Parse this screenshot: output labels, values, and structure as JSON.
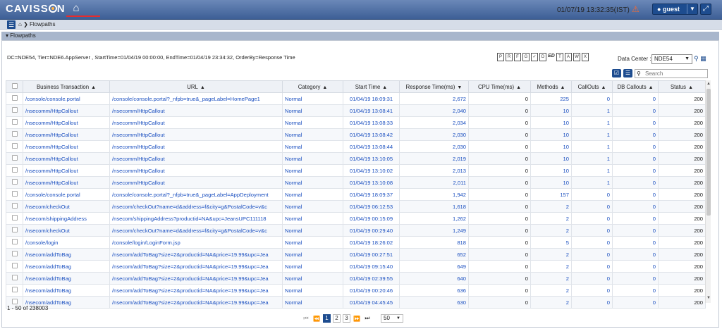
{
  "header": {
    "logo": "CAVISSON",
    "logo_left": "CAVISS",
    "logo_right": "N",
    "datetime": "01/07/19 13:32:35(IST)",
    "user": "guest"
  },
  "breadcrumb": {
    "label": "Flowpaths"
  },
  "panel": {
    "title": "Flowpaths"
  },
  "info": "DC=NDE54, Tier=NDE6.AppServer , StartTime=01/04/19 00:00:00, EndTime=01/04/19 23:34:32, OrderBy=Response Time",
  "datacenter": {
    "label": "Data Center :",
    "value": "NDE54"
  },
  "search": {
    "placeholder": "Search"
  },
  "columns": [
    "Business Transaction",
    "URL",
    "Category",
    "Start Time",
    "Response Time(ms)",
    "CPU Time(ms)",
    "Methods",
    "CallOuts",
    "DB Callouts",
    "Status"
  ],
  "rows": [
    [
      "/console/console.portal",
      "/console/console.portal?_nfpb=true&_pageLabel=HomePage1",
      "Normal",
      "01/04/19 18:09:31",
      "2,672",
      "0",
      "225",
      "0",
      "0",
      "200"
    ],
    [
      "/nsecomm/HttpCallout",
      "/nsecomm/HttpCallout",
      "Normal",
      "01/04/19 13:08:41",
      "2,040",
      "0",
      "10",
      "1",
      "0",
      "200"
    ],
    [
      "/nsecomm/HttpCallout",
      "/nsecomm/HttpCallout",
      "Normal",
      "01/04/19 13:08:33",
      "2,034",
      "0",
      "10",
      "1",
      "0",
      "200"
    ],
    [
      "/nsecomm/HttpCallout",
      "/nsecomm/HttpCallout",
      "Normal",
      "01/04/19 13:08:42",
      "2,030",
      "0",
      "10",
      "1",
      "0",
      "200"
    ],
    [
      "/nsecomm/HttpCallout",
      "/nsecomm/HttpCallout",
      "Normal",
      "01/04/19 13:08:44",
      "2,030",
      "0",
      "10",
      "1",
      "0",
      "200"
    ],
    [
      "/nsecomm/HttpCallout",
      "/nsecomm/HttpCallout",
      "Normal",
      "01/04/19 13:10:05",
      "2,019",
      "0",
      "10",
      "1",
      "0",
      "200"
    ],
    [
      "/nsecomm/HttpCallout",
      "/nsecomm/HttpCallout",
      "Normal",
      "01/04/19 13:10:02",
      "2,013",
      "0",
      "10",
      "1",
      "0",
      "200"
    ],
    [
      "/nsecomm/HttpCallout",
      "/nsecomm/HttpCallout",
      "Normal",
      "01/04/19 13:10:08",
      "2,011",
      "0",
      "10",
      "1",
      "0",
      "200"
    ],
    [
      "/console/console.portal",
      "/console/console.portal?_nfpb=true&_pageLabel=AppDeployment",
      "Normal",
      "01/04/19 18:09:37",
      "1,942",
      "0",
      "157",
      "0",
      "0",
      "200"
    ],
    [
      "/nsecom/checkOut",
      "/nsecom/checkOut?name=d&address=f&city=g&PostalCode=v&c",
      "Normal",
      "01/04/19 06:12:53",
      "1,618",
      "0",
      "2",
      "0",
      "0",
      "200"
    ],
    [
      "/nsecom/shippingAddress",
      "/nsecom/shippingAddress?productid=NA&upc=JeansUPC111118",
      "Normal",
      "01/04/19 00:15:09",
      "1,262",
      "0",
      "2",
      "0",
      "0",
      "200"
    ],
    [
      "/nsecom/checkOut",
      "/nsecom/checkOut?name=d&address=f&city=g&PostalCode=v&c",
      "Normal",
      "01/04/19 00:29:40",
      "1,249",
      "0",
      "2",
      "0",
      "0",
      "200"
    ],
    [
      "/console/login",
      "/console/login/LoginForm.jsp",
      "Normal",
      "01/04/19 18:26:02",
      "818",
      "0",
      "5",
      "0",
      "0",
      "200"
    ],
    [
      "/nsecom/addToBag",
      "/nsecom/addToBag?size=2&productid=NA&price=19.99&upc=Jea",
      "Normal",
      "01/04/19 00:27:51",
      "652",
      "0",
      "2",
      "0",
      "0",
      "200"
    ],
    [
      "/nsecom/addToBag",
      "/nsecom/addToBag?size=2&productid=NA&price=19.99&upc=Jea",
      "Normal",
      "01/04/19 09:15:40",
      "649",
      "0",
      "2",
      "0",
      "0",
      "200"
    ],
    [
      "/nsecom/addToBag",
      "/nsecom/addToBag?size=2&productid=NA&price=19.99&upc=Jea",
      "Normal",
      "01/04/19 02:39:55",
      "640",
      "0",
      "2",
      "0",
      "0",
      "200"
    ],
    [
      "/nsecom/addToBag",
      "/nsecom/addToBag?size=2&productid=NA&price=19.99&upc=Jea",
      "Normal",
      "01/04/19 00:20:46",
      "636",
      "0",
      "2",
      "0",
      "0",
      "200"
    ],
    [
      "/nsecom/addToBag",
      "/nsecom/addToBag?size=2&productid=NA&price=19.99&upc=Jea",
      "Normal",
      "01/04/19 04:45:45",
      "630",
      "0",
      "2",
      "0",
      "0",
      "200"
    ]
  ],
  "footer": {
    "count": "1 - 50 of 238003",
    "pages": [
      "1",
      "2",
      "3"
    ],
    "rows_per_page": "50"
  },
  "colors": {
    "accent": "#1d4c8f",
    "link": "#1a4fc0",
    "header": "#3d5f96"
  },
  "icons": [
    "home-icon",
    "menu-icon",
    "user-icon",
    "expand-icon",
    "search-icon",
    "export-pdf-icon",
    "export-word-icon",
    "export-excel-icon"
  ]
}
